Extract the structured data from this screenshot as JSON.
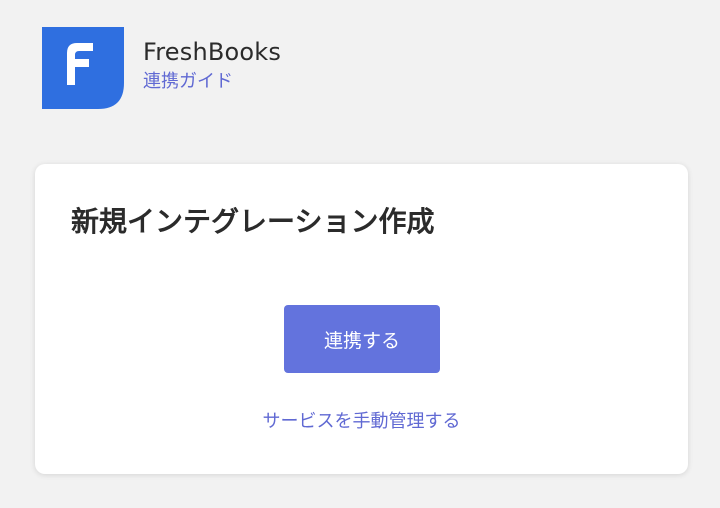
{
  "header": {
    "app_name": "FreshBooks",
    "guide_link": "連携ガイド",
    "logo_icon": "freshbooks-logo-icon",
    "logo_color": "#2f6fe0"
  },
  "card": {
    "title": "新規インテグレーション作成",
    "connect_button": "連携する",
    "manual_link": "サービスを手動管理する"
  },
  "colors": {
    "background": "#f2f2f2",
    "button": "#6373dd",
    "link": "#6069d3"
  }
}
